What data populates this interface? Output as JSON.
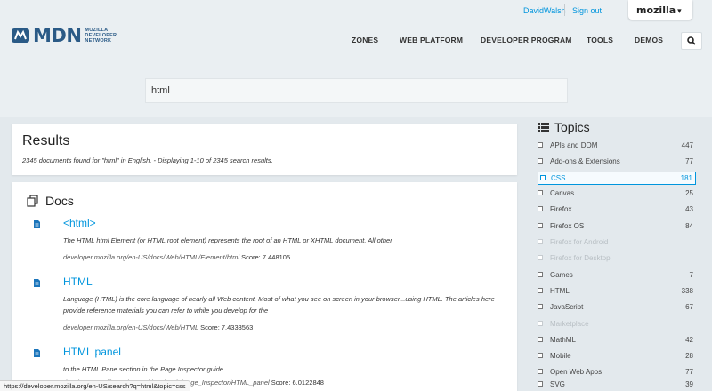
{
  "userbar": {
    "username": "DavidWalsh",
    "signout": "Sign out",
    "mozilla": "mozilla"
  },
  "logo": {
    "word": "MDN",
    "sub1": "MOZILLA",
    "sub2": "DEVELOPER",
    "sub3": "NETWORK"
  },
  "nav": {
    "zones": "ZONES",
    "web_platform": "WEB PLATFORM",
    "developer_program": "DEVELOPER PROGRAM",
    "tools": "TOOLS",
    "demos": "DEMOS"
  },
  "search": {
    "value": "html"
  },
  "results": {
    "title": "Results",
    "summary": "2345 documents found for \"html\" in English. - Displaying 1-10 of 2345 search results."
  },
  "docs": {
    "heading": "Docs",
    "items": [
      {
        "title": "<html>",
        "excerpt": "The HTML html Element (or HTML root element) represents the root of an HTML or XHTML document. All other",
        "url": "developer.mozilla.org/en-US/docs/Web/HTML/Element/html",
        "score": "Score: 7.448105"
      },
      {
        "title": "HTML",
        "excerpt": "Language (HTML) is the core language of nearly all Web content. Most of what you see on screen in your browser...using HTML. The articles here provide reference materials you can refer to while you develop for the",
        "url": "developer.mozilla.org/en-US/docs/Web/HTML",
        "score": "Score: 7.4333563"
      },
      {
        "title": "HTML panel",
        "excerpt": "to the HTML Pane section in the Page Inspector guide.",
        "url": "developer.mozilla.org/en-US/docs/Tools/Page_Inspector/HTML_panel",
        "score": "Score: 6.0122848"
      }
    ]
  },
  "topics": {
    "heading": "Topics",
    "items": [
      {
        "name": "APIs and DOM",
        "count": "447"
      },
      {
        "name": "Add-ons & Extensions",
        "count": "77"
      },
      {
        "name": "CSS",
        "count": "181"
      },
      {
        "name": "Canvas",
        "count": "25"
      },
      {
        "name": "Firefox",
        "count": "43"
      },
      {
        "name": "Firefox OS",
        "count": "84"
      },
      {
        "name": "Firefox for Android",
        "count": ""
      },
      {
        "name": "Firefox for Desktop",
        "count": ""
      },
      {
        "name": "Games",
        "count": "7"
      },
      {
        "name": "HTML",
        "count": "338"
      },
      {
        "name": "JavaScript",
        "count": "67"
      },
      {
        "name": "Marketplace",
        "count": ""
      },
      {
        "name": "MathML",
        "count": "42"
      },
      {
        "name": "Mobile",
        "count": "28"
      },
      {
        "name": "Open Web Apps",
        "count": "77"
      },
      {
        "name": "SVG",
        "count": "39"
      }
    ]
  },
  "status": {
    "url": "https://developer.mozilla.org/en-US/search?q=html&topic=css"
  },
  "colors": {
    "link": "#0095dd",
    "brand": "#2a5a86",
    "background": "#eaeff2"
  }
}
